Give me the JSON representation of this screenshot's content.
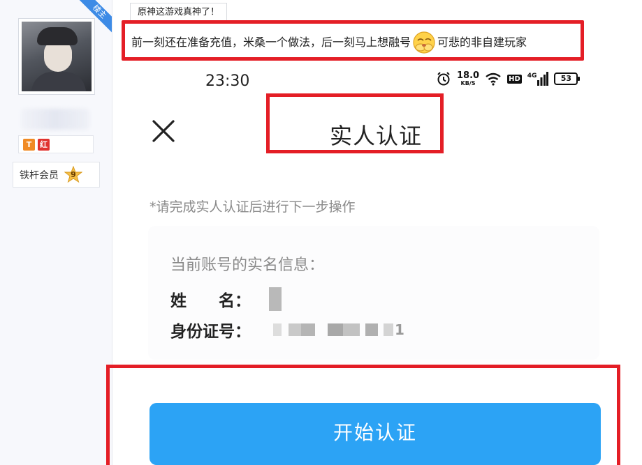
{
  "author": {
    "ribbon_label": "楼主",
    "badge_t": "T",
    "badge_red": "红",
    "member_label": "铁杆会员",
    "member_level": "9"
  },
  "post": {
    "title": "原神这游戏真神了！",
    "text_before_emoji": "前一刻还在准备充值，米桑一个做法，后一刻马上想融号",
    "text_after_emoji": "可悲的非自建玩家",
    "emoji_icon": "covering-face-emoji-icon"
  },
  "phone": {
    "status": {
      "time": "23:30",
      "speed_value": "18.0",
      "speed_unit": "KB/S",
      "hd_label": "HD",
      "network": "4G",
      "battery": "53"
    },
    "page_title": "实人认证",
    "close_icon": "close-icon",
    "hint": "*请完成实人认证后进行下一步操作",
    "info": {
      "title": "当前账号的实名信息：",
      "name_label": "姓　　名：",
      "id_label": "身份证号：",
      "id_last_char": "1"
    },
    "start_button": "开始认证"
  },
  "colors": {
    "highlight_red": "#e41e26",
    "button_blue": "#2ca3f5",
    "ribbon_blue": "#3d8be6"
  }
}
